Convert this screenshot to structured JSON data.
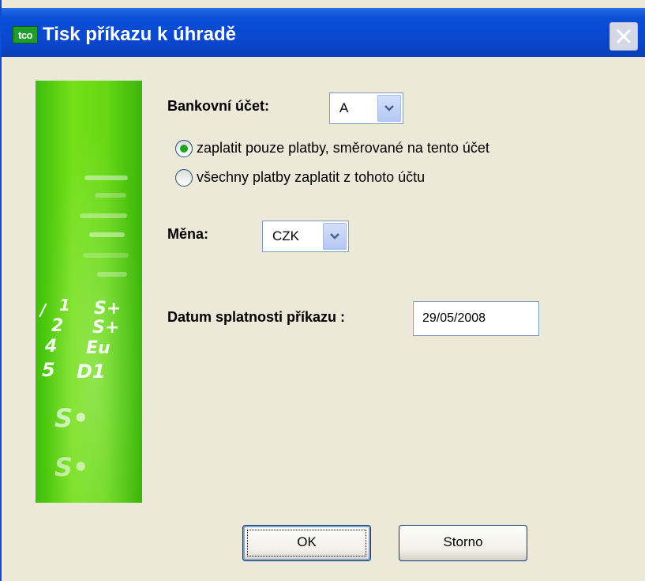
{
  "window": {
    "title": "Tisk příkazu k úhradě",
    "app_icon_text": "tco"
  },
  "form": {
    "account_label": "Bankovní účet:",
    "account_value": "A",
    "radio_options": [
      {
        "label": "zaplatit pouze platby, směrované na tento účet",
        "selected": true
      },
      {
        "label": "všechny platby zaplatit z tohoto účtu",
        "selected": false
      }
    ],
    "currency_label": "Měna:",
    "currency_value": "CZK",
    "due_date_label": "Datum splatnosti příkazu :",
    "due_date_value": "29/05/2008"
  },
  "banner": {
    "glyphs": [
      "/",
      "1",
      "S+",
      "2",
      "S+",
      "4",
      "Eu",
      "5",
      "D1",
      "S•",
      "S•"
    ]
  },
  "buttons": {
    "ok_label": "OK",
    "cancel_label": "Storno"
  },
  "colors": {
    "title_bar": "#0a46cc",
    "dialog_bg": "#ece9d8",
    "radio_selected": "#21a121",
    "banner_green": "#66d812"
  },
  "icons": {
    "app": "tco-logo-icon",
    "close": "close-icon",
    "dropdown": "chevron-down-icon"
  }
}
